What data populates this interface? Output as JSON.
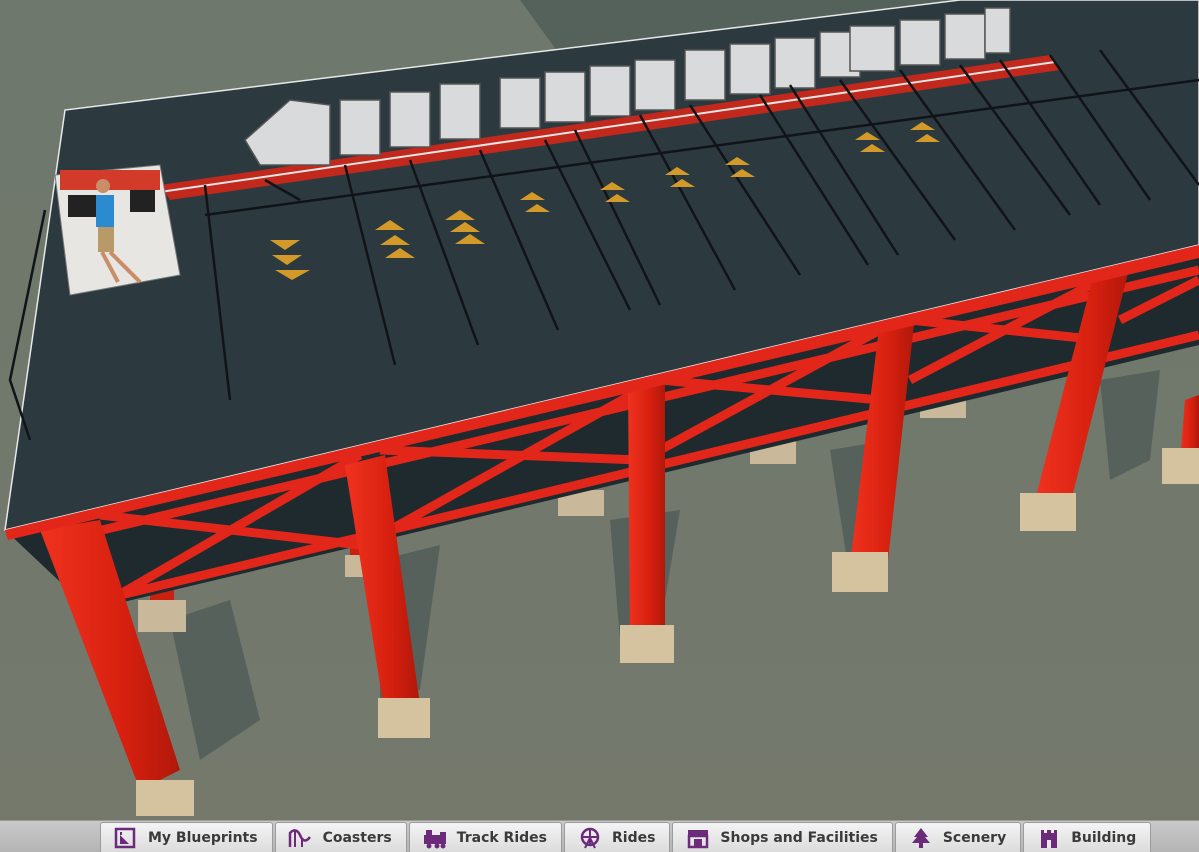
{
  "colors": {
    "ground": "#6f776c",
    "deck": "#2c3a3f",
    "steel": "#e2261a",
    "tab_icon": "#6b2a7a"
  },
  "toolbar": {
    "tabs": [
      {
        "label": "My Blueprints",
        "icon": "blueprint-icon"
      },
      {
        "label": "Coasters",
        "icon": "coaster-icon"
      },
      {
        "label": "Track Rides",
        "icon": "train-icon"
      },
      {
        "label": "Rides",
        "icon": "ferris-wheel-icon"
      },
      {
        "label": "Shops and Facilities",
        "icon": "shop-icon"
      },
      {
        "label": "Scenery",
        "icon": "tree-icon"
      },
      {
        "label": "Building",
        "icon": "castle-icon"
      }
    ]
  }
}
